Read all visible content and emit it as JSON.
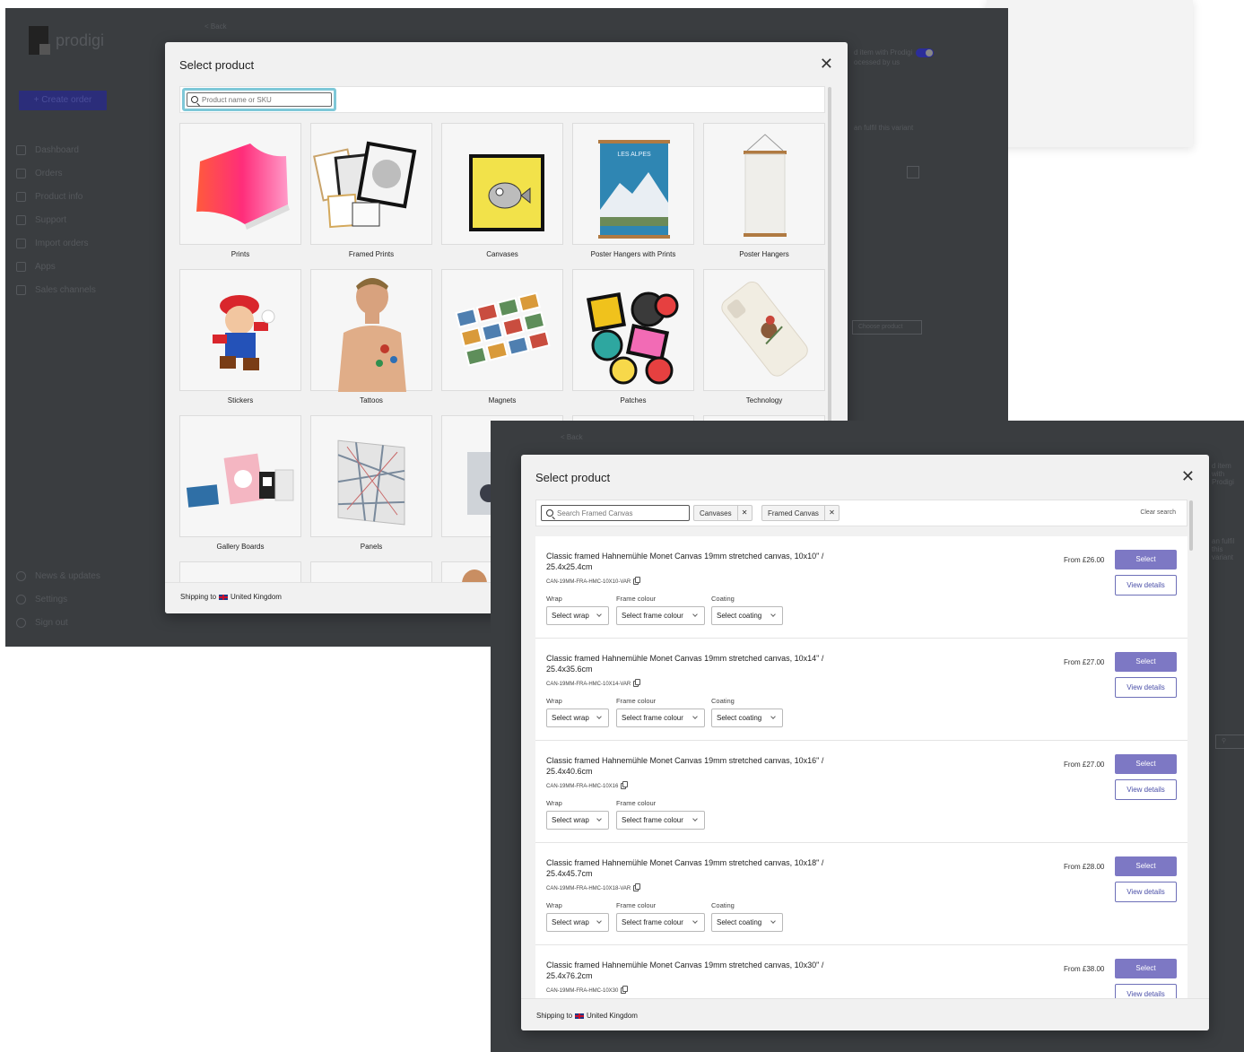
{
  "background_app": {
    "brand": "prodigi",
    "create_order_label": "+ Create order",
    "nav_items": [
      "Dashboard",
      "Orders",
      "Product info",
      "Support",
      "Import orders",
      "Apps",
      "Sales channels"
    ],
    "nav_bottom_items": [
      "News & updates",
      "Settings",
      "Sign out"
    ],
    "back_link": "< Back",
    "fulfil_text_1": "d item with Prodigi",
    "fulfil_text_2": "ocessed by us",
    "fulfil_text_3": "an fulfil this variant",
    "choose_product_label": "Choose product"
  },
  "category_modal": {
    "title": "Select product",
    "search_placeholder": "Product name or SKU",
    "categories": [
      "Prints",
      "Framed Prints",
      "Canvases",
      "Poster Hangers with Prints",
      "Poster Hangers",
      "Stickers",
      "Tattoos",
      "Magnets",
      "Patches",
      "Technology",
      "Gallery Boards",
      "Panels"
    ],
    "poster_text": "LES ALPES",
    "shipping_prefix": "Shipping to",
    "shipping_country": "United Kingdom"
  },
  "product_modal": {
    "title": "Select product",
    "search_placeholder": "Search Framed Canvas",
    "filters": [
      "Canvases",
      "Framed Canvas"
    ],
    "clear_search": "Clear search",
    "wrap_label": "Wrap",
    "frame_label": "Frame colour",
    "coating_label": "Coating",
    "wrap_select": "Select wrap",
    "frame_select": "Select frame colour",
    "coating_select": "Select coating",
    "select_button": "Select",
    "details_button": "View details",
    "products": [
      {
        "title": "Classic framed Hahnemühle Monet Canvas 19mm stretched canvas, 10x10\" / 25.4x25.4cm",
        "sku": "CAN-19MM-FRA-HMC-10X10-VAR",
        "price": "From £26.00"
      },
      {
        "title": "Classic framed Hahnemühle Monet Canvas 19mm stretched canvas, 10x14\" / 25.4x35.6cm",
        "sku": "CAN-19MM-FRA-HMC-10X14-VAR",
        "price": "From £27.00"
      },
      {
        "title": "Classic framed Hahnemühle Monet Canvas 19mm stretched canvas, 10x16\" / 25.4x40.6cm",
        "sku": "CAN-19MM-FRA-HMC-10X16",
        "price": "From £27.00"
      },
      {
        "title": "Classic framed Hahnemühle Monet Canvas 19mm stretched canvas, 10x18\" / 25.4x45.7cm",
        "sku": "CAN-19MM-FRA-HMC-10X18-VAR",
        "price": "From £28.00"
      },
      {
        "title": "Classic framed Hahnemühle Monet Canvas 19mm stretched canvas, 10x30\" / 25.4x76.2cm",
        "sku": "CAN-19MM-FRA-HMC-10X30",
        "price": "From £38.00"
      }
    ],
    "shipping_prefix": "Shipping to",
    "shipping_country": "United Kingdom"
  },
  "colors": {
    "overlay": "#3a3d40",
    "accent": "#7d78c4",
    "search_focus": "#7ec8d8"
  }
}
